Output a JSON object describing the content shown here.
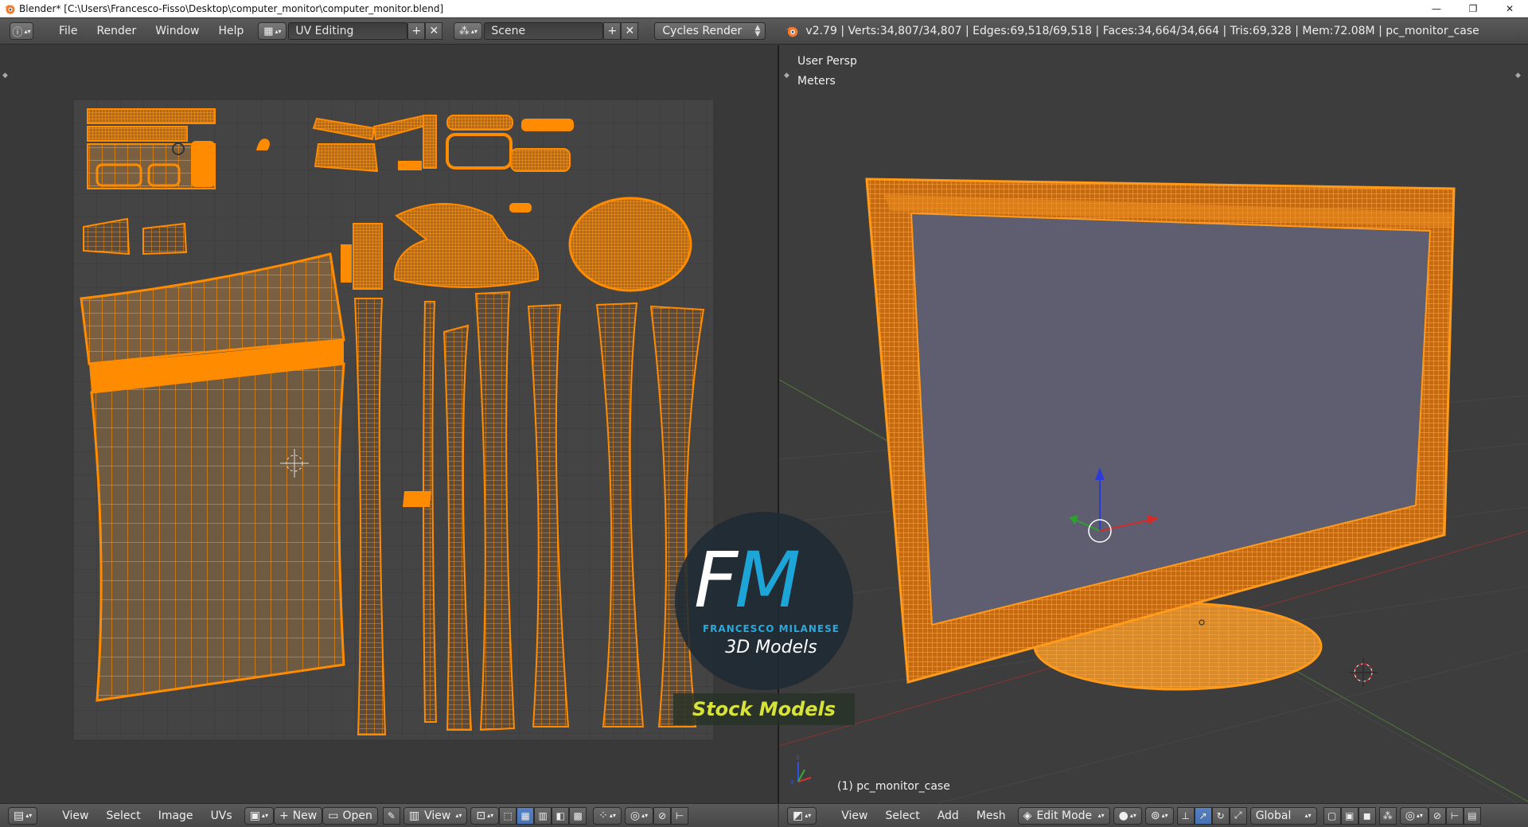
{
  "window": {
    "title": "Blender* [C:\\Users\\Francesco-Fisso\\Desktop\\computer_monitor\\computer_monitor.blend]",
    "minimize": "—",
    "restore": "❐",
    "close": "✕"
  },
  "infobar": {
    "menus": [
      "File",
      "Render",
      "Window",
      "Help"
    ],
    "layout": "UV Editing",
    "scene": "Scene",
    "engine": "Cycles Render",
    "stats": "v2.79 | Verts:34,807/34,807 | Edges:69,518/69,518 | Faces:34,664/34,664 | Tris:69,328 | Mem:72.08M | pc_monitor_case"
  },
  "view3d": {
    "view_name": "User Persp",
    "units": "Meters",
    "object_label": "(1) pc_monitor_case"
  },
  "uv_footer": {
    "menus": [
      "View",
      "Select",
      "Image",
      "UVs"
    ],
    "new_label": "New",
    "open_label": "Open",
    "view_label": "View"
  },
  "v3d_footer": {
    "menus": [
      "View",
      "Select",
      "Add",
      "Mesh"
    ],
    "mode": "Edit Mode",
    "orientation": "Global"
  },
  "watermark": {
    "f": "F",
    "m": "M",
    "name": "FRANCESCO MILANESE",
    "sub": "3D Models",
    "stock": "Stock Models"
  },
  "colors": {
    "uv_orange": "#ff8c00",
    "mesh_orange": "#ff9a1a",
    "screen": "#5d5d6e",
    "accent_blue": "#5680c2"
  }
}
